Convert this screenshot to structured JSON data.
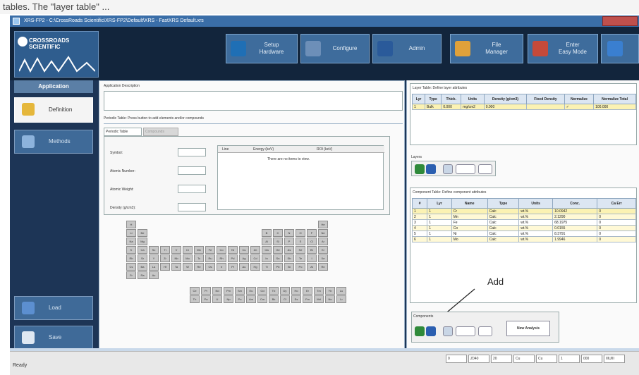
{
  "top_caption": "tables. The \"layer table\" ...",
  "window": {
    "title": "XRS-FP2 - C:\\CrossRoads Scientific\\XRS-FP2\\Default\\XRS - FastXRS Default.xrs"
  },
  "logo": {
    "line1": "CROSSROADS",
    "line2": "SCIENTIFIC"
  },
  "toolbar": {
    "setup": [
      "Setup",
      "Hardware"
    ],
    "configure": "Configure",
    "admin": "Admin",
    "file": [
      "File",
      "Manager"
    ],
    "easy": [
      "Enter",
      "Easy Mode"
    ]
  },
  "sidebar": {
    "heading": "Application",
    "definition": "Definition",
    "methods": "Methods",
    "load": "Load",
    "save": "Save"
  },
  "main": {
    "app_desc_label": "Application Description",
    "periodic_hint": "Periodic Table: Press button to add elements and/or compounds",
    "tab_periodic": "Periodic Table",
    "tab_compounds": "Compounds",
    "fields": {
      "symbol": "Symbol:",
      "atomic_number": "Atomic Number:",
      "atomic_weight": "Atomic Weight:",
      "density": "Density (g/cm3):"
    },
    "line_table": {
      "line": "Line",
      "energy": "Energy (keV)",
      "roi": "ROI (keV)",
      "empty": "There are no items to view."
    }
  },
  "periodic": {
    "rows": [
      [
        "H",
        "",
        "",
        "",
        "",
        "",
        "",
        "",
        "",
        "",
        "",
        "",
        "",
        "",
        "",
        "",
        "",
        "He"
      ],
      [
        "Li",
        "Be",
        "",
        "",
        "",
        "",
        "",
        "",
        "",
        "",
        "",
        "",
        "B",
        "C",
        "N",
        "O",
        "F",
        "Ne"
      ],
      [
        "Na",
        "Mg",
        "",
        "",
        "",
        "",
        "",
        "",
        "",
        "",
        "",
        "",
        "Al",
        "Si",
        "P",
        "S",
        "Cl",
        "Ar"
      ],
      [
        "K",
        "Ca",
        "Sc",
        "Ti",
        "V",
        "Cr",
        "Mn",
        "Fe",
        "Co",
        "Ni",
        "Cu",
        "Zn",
        "Ga",
        "Ge",
        "As",
        "Se",
        "Br",
        "Kr"
      ],
      [
        "Rb",
        "Sr",
        "Y",
        "Zr",
        "Nb",
        "Mo",
        "Tc",
        "Ru",
        "Rh",
        "Pd",
        "Ag",
        "Cd",
        "In",
        "Sn",
        "Sb",
        "Te",
        "I",
        "Xe"
      ],
      [
        "Cs",
        "Ba",
        "La",
        "Hf",
        "Ta",
        "W",
        "Re",
        "Os",
        "Ir",
        "Pt",
        "Au",
        "Hg",
        "Tl",
        "Pb",
        "Bi",
        "Po",
        "At",
        "Rn"
      ],
      [
        "Fr",
        "Ra",
        "Ac",
        "",
        "",
        "",
        "",
        "",
        "",
        "",
        "",
        "",
        "",
        "",
        "",
        "",
        "",
        ""
      ]
    ],
    "lanth": [
      "Ce",
      "Pr",
      "Nd",
      "Pm",
      "Sm",
      "Eu",
      "Gd",
      "Tb",
      "Dy",
      "Ho",
      "Er",
      "Tm",
      "Yb",
      "Lu"
    ],
    "actin": [
      "Th",
      "Pa",
      "U",
      "Np",
      "Pu",
      "Am",
      "Cm",
      "Bk",
      "Cf",
      "Es",
      "Fm",
      "Md",
      "No",
      "Lr"
    ]
  },
  "layer_table": {
    "caption": "Layer Table: Define layer attributes",
    "headers": [
      "Lyr",
      "Type",
      "Thick.",
      "Units",
      "Density (g/cm3)",
      "Fixed Density",
      "Normalize",
      "Normalize Total"
    ],
    "rows": [
      [
        "1",
        "Bulk",
        "0.000",
        "mg/cm2",
        "0.000",
        "",
        "✓",
        "100.000"
      ]
    ]
  },
  "layers_group": {
    "label": "Layers"
  },
  "component_table": {
    "caption": "Component Table: Define component attributes",
    "headers": [
      "#",
      "Lyr",
      "Name",
      "Type",
      "Units",
      "Conc.",
      "Ca Err"
    ],
    "rows": [
      [
        "1",
        "1",
        "Cr",
        "Calc",
        "wt.%",
        "10.0942",
        "0"
      ],
      [
        "2",
        "1",
        "Mn",
        "Calc",
        "wt.%",
        "2.1290",
        "0"
      ],
      [
        "3",
        "1",
        "Fe",
        "Calc",
        "wt.%",
        "68.1975",
        "0"
      ],
      [
        "4",
        "1",
        "Co",
        "Calc",
        "wt.%",
        "0.0155",
        "0"
      ],
      [
        "5",
        "1",
        "Ni",
        "Calc",
        "wt.%",
        "8.3791",
        "0"
      ],
      [
        "6",
        "1",
        "Mo",
        "Calc",
        "wt.%",
        "1.9946",
        "0"
      ]
    ]
  },
  "components_group": {
    "label": "Components",
    "new_analysis": "New Analysis"
  },
  "annotation": {
    "add": "Add"
  },
  "status": {
    "ready": "Ready",
    "cells": [
      "0",
      "Z040",
      "20",
      "Cu",
      "Cu",
      "1",
      "000",
      "IIIUIII"
    ]
  }
}
